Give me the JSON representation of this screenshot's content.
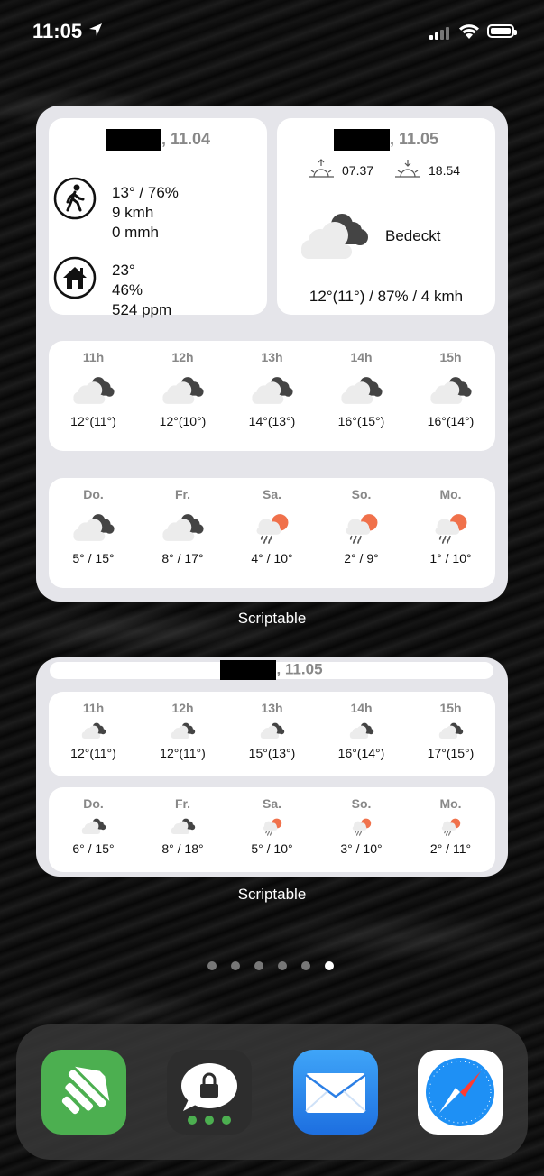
{
  "status_bar": {
    "time": "11:05"
  },
  "widget1": {
    "left_card": {
      "date": ", 11.04",
      "outdoor_line1": "13° / 76%",
      "outdoor_line2": "9 kmh",
      "outdoor_line3": "0 mmh",
      "indoor_line1": "23°",
      "indoor_line2": "46%",
      "indoor_line3": "524 ppm"
    },
    "right_card": {
      "date": ", 11.05",
      "sunrise": "07.37",
      "sunset": "18.54",
      "condition": "Bedeckt",
      "summary": "12°(11°) / 87% / 4 kmh"
    },
    "hourly": [
      {
        "label": "11h",
        "temp": "12°(11°)",
        "icon": "cloudy-icon"
      },
      {
        "label": "12h",
        "temp": "12°(10°)",
        "icon": "cloudy-icon"
      },
      {
        "label": "13h",
        "temp": "14°(13°)",
        "icon": "cloudy-icon"
      },
      {
        "label": "14h",
        "temp": "16°(15°)",
        "icon": "cloudy-icon"
      },
      {
        "label": "15h",
        "temp": "16°(14°)",
        "icon": "cloudy-icon"
      }
    ],
    "daily": [
      {
        "label": "Do.",
        "temp": "5° / 15°",
        "icon": "cloudy-icon"
      },
      {
        "label": "Fr.",
        "temp": "8° / 17°",
        "icon": "cloudy-icon"
      },
      {
        "label": "Sa.",
        "temp": "4° / 10°",
        "icon": "rain-sun-icon"
      },
      {
        "label": "So.",
        "temp": "2° / 9°",
        "icon": "rain-sun-icon"
      },
      {
        "label": "Mo.",
        "temp": "1° / 10°",
        "icon": "rain-sun-icon"
      }
    ],
    "label": "Scriptable"
  },
  "widget2": {
    "date": ", 11.05",
    "hourly": [
      {
        "label": "11h",
        "temp": "12°(11°)",
        "icon": "cloudy-icon"
      },
      {
        "label": "12h",
        "temp": "12°(11°)",
        "icon": "cloudy-icon"
      },
      {
        "label": "13h",
        "temp": "15°(13°)",
        "icon": "cloudy-icon"
      },
      {
        "label": "14h",
        "temp": "16°(14°)",
        "icon": "cloudy-icon"
      },
      {
        "label": "15h",
        "temp": "17°(15°)",
        "icon": "cloudy-icon"
      }
    ],
    "daily": [
      {
        "label": "Do.",
        "temp": "6° / 15°",
        "icon": "cloudy-icon"
      },
      {
        "label": "Fr.",
        "temp": "8° / 18°",
        "icon": "cloudy-icon"
      },
      {
        "label": "Sa.",
        "temp": "5° / 10°",
        "icon": "rain-sun-icon"
      },
      {
        "label": "So.",
        "temp": "3° / 10°",
        "icon": "rain-sun-icon"
      },
      {
        "label": "Mo.",
        "temp": "2° / 11°",
        "icon": "rain-sun-icon"
      }
    ],
    "label": "Scriptable"
  },
  "page_dots": {
    "count": 6,
    "active": 6
  },
  "dock": [
    {
      "name": "feedly-app-icon",
      "color": "#4caf50"
    },
    {
      "name": "threema-app-icon",
      "color": "#2d2d2d"
    },
    {
      "name": "mail-app-icon",
      "color": "#2e8ef0"
    },
    {
      "name": "safari-app-icon",
      "color": "#ffffff"
    }
  ]
}
